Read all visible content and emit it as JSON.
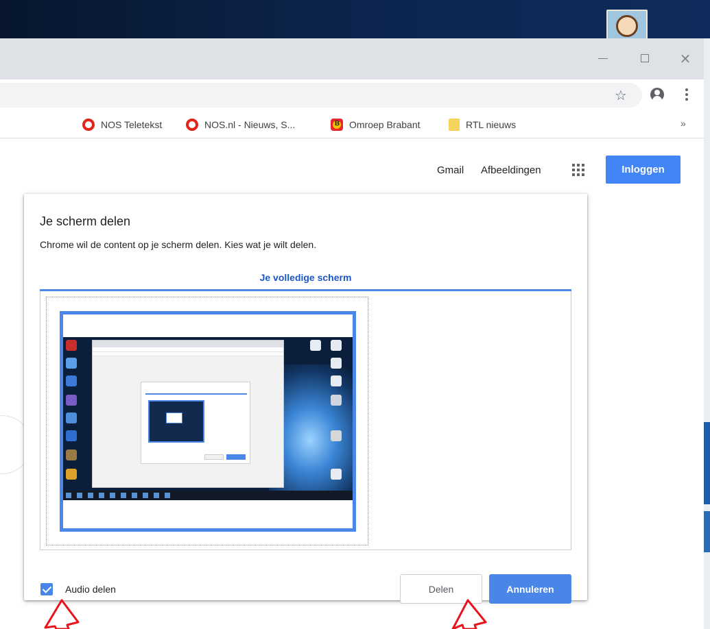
{
  "window": {
    "close_glyph": "×"
  },
  "toolbar": {
    "star_glyph": "☆"
  },
  "bookmarks": [
    {
      "label": "NOS Teletekst",
      "icon": "nos-icon"
    },
    {
      "label": "NOS.nl - Nieuws, S...",
      "icon": "nos-icon"
    },
    {
      "label": "Omroep Brabant",
      "icon": "omroep-brabant-icon",
      "badge": "B"
    },
    {
      "label": "RTL nieuws",
      "icon": "folder-icon"
    }
  ],
  "bookmarks_more": "»",
  "google": {
    "gmail": "Gmail",
    "images": "Afbeeldingen",
    "signin": "Inloggen"
  },
  "dialog": {
    "title": "Je scherm delen",
    "subtitle": "Chrome wil de content op je scherm delen. Kies wat je wilt delen.",
    "tab": "Je volledige scherm",
    "audio_label": "Audio delen",
    "audio_checked": true,
    "share_label": "Delen",
    "cancel_label": "Annuleren"
  },
  "colors": {
    "accent": "#4a86e8",
    "signin": "#4285f4",
    "tab_text": "#1a56c4",
    "annotation": "#e8141b"
  }
}
